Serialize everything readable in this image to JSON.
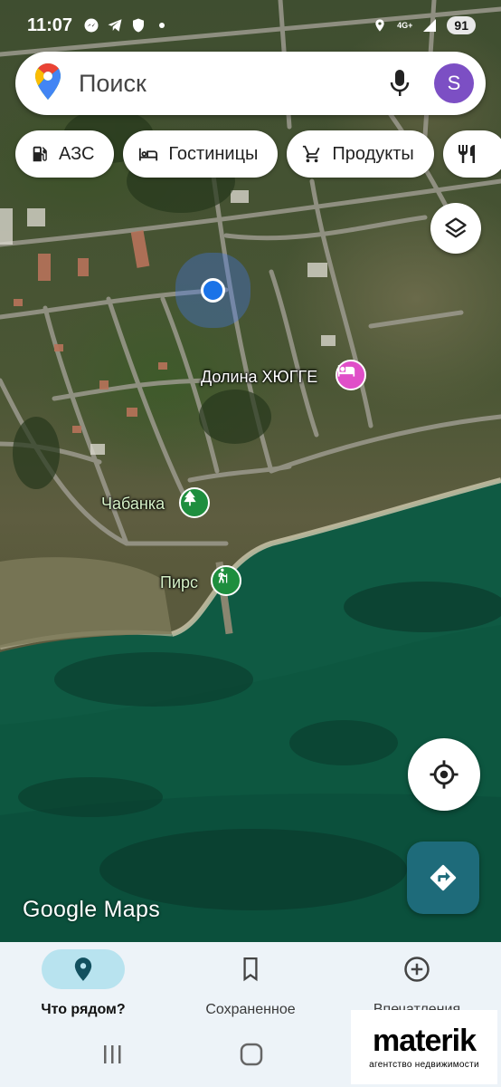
{
  "status_bar": {
    "time": "11:07",
    "network": "4G+",
    "battery": "91"
  },
  "search": {
    "placeholder": "Поиск",
    "avatar_letter": "S"
  },
  "chips": [
    {
      "label": "АЗС",
      "icon": "gas-station-icon"
    },
    {
      "label": "Гостиницы",
      "icon": "bed-icon"
    },
    {
      "label": "Продукты",
      "icon": "cart-icon"
    },
    {
      "label": "",
      "icon": "restaurant-icon"
    }
  ],
  "map": {
    "pois": [
      {
        "label": "Долина ХЮГГЕ",
        "icon": "hotel-icon",
        "color": "#e04ec8"
      },
      {
        "label": "Чабанка",
        "icon": "tree-icon",
        "color": "#1e8e3e"
      },
      {
        "label": "Пирс",
        "icon": "hiking-icon",
        "color": "#1e8e3e"
      }
    ],
    "watermark": "Google Maps"
  },
  "bottom_nav": [
    {
      "label": "Что рядом?",
      "icon": "location-pin-icon",
      "active": true
    },
    {
      "label": "Сохраненное",
      "icon": "bookmark-icon",
      "active": false
    },
    {
      "label": "Впечатления",
      "icon": "add-circle-icon",
      "active": false
    }
  ],
  "brand": {
    "name": "materik",
    "subtitle": "агентство недвижимости"
  },
  "colors": {
    "accent": "#1a73e8",
    "directions": "#1e6b7a",
    "nav_active": "#b8e3ef",
    "avatar": "#7c4fc4"
  }
}
